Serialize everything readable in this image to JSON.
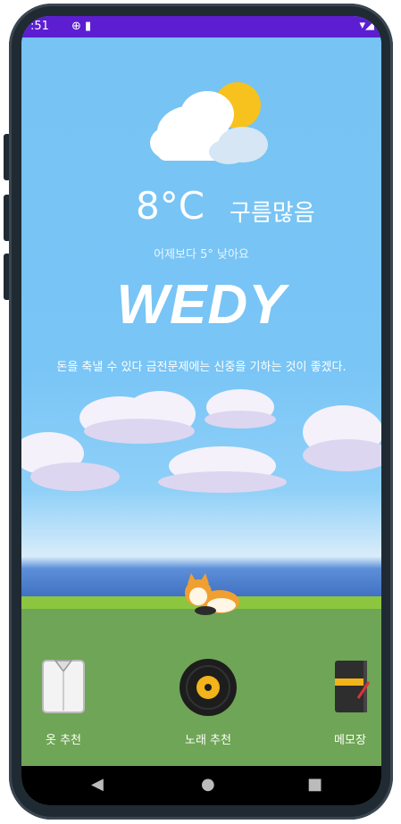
{
  "status": {
    "time": ":51",
    "left_icons": "⊕ ▮",
    "right_icons": "▾◢"
  },
  "weather": {
    "temperature": "8°C",
    "condition": "구름많음",
    "comparison": "어제보다 5° 낮아요",
    "icon": "partly-cloudy-icon"
  },
  "app": {
    "logo": "WEDY"
  },
  "quote": "돈을 축낼 수 있다 금전문제에는 신중을 기하는 것이 좋겠다.",
  "menu": [
    {
      "label": "옷 추천",
      "icon": "shirt-icon"
    },
    {
      "label": "노래 추천",
      "icon": "vinyl-record-icon"
    },
    {
      "label": "메모장",
      "icon": "notebook-icon"
    }
  ],
  "nav": {
    "back": "◀",
    "home": "●",
    "recents": "■"
  },
  "colors": {
    "status_bar": "#5d1ed1",
    "sky": "#76c3f4",
    "grass": "#6fa556"
  }
}
